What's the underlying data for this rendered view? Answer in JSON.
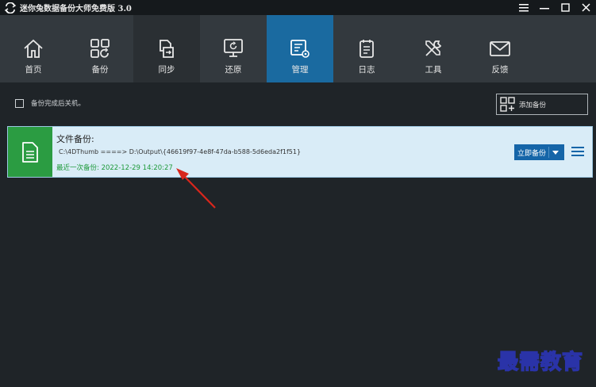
{
  "window": {
    "title": "迷你兔数据备份大师免费版 3.0",
    "logo_icon": "swap-arrows-logo",
    "controls": [
      "menu-icon",
      "minimize-icon",
      "maximize-icon",
      "close-icon"
    ]
  },
  "toolbar": {
    "items": [
      {
        "label": "首页",
        "icon": "home-icon"
      },
      {
        "label": "备份",
        "icon": "backup-grid-icon"
      },
      {
        "label": "同步",
        "icon": "sync-icon"
      },
      {
        "label": "还原",
        "icon": "restore-monitor-icon"
      },
      {
        "label": "管理",
        "icon": "manage-icon",
        "active": true
      },
      {
        "label": "日志",
        "icon": "log-icon"
      },
      {
        "label": "工具",
        "icon": "tools-icon"
      },
      {
        "label": "反馈",
        "icon": "mail-icon"
      }
    ],
    "active_color": "#1a6aa0"
  },
  "options": {
    "shutdown_label": "备份完成后关机。",
    "shutdown_checked": false,
    "add_backup_label": "添加备份"
  },
  "task": {
    "title": "文件备份:",
    "path": "C:\\4DThumb ====> D:\\Output\\{46619f97-4e8f-47da-b588-5d6eda2f1f51}",
    "last_backup": "最近一次备份: 2022-12-29 14:20:27",
    "backup_now_label": "立即备份",
    "icon": "document-icon",
    "icon_color": "#2b9c42"
  },
  "watermark": "最需教育"
}
